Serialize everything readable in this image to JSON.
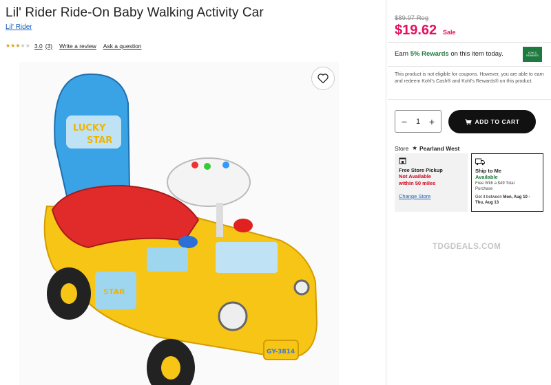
{
  "product": {
    "title": "Lil' Rider Ride-On Baby Walking Activity Car",
    "brand": "Lil' Rider",
    "rating": {
      "stars_filled": 3,
      "stars_total": 5,
      "score": "3.0",
      "count": "(3)"
    },
    "write_review": "Write a review",
    "ask_question": "Ask a question"
  },
  "pricing": {
    "regular": "$89.97 Reg",
    "price": "$19.62",
    "sale_label": "Sale",
    "accent_color": "#e0115f"
  },
  "rewards": {
    "prefix": "Earn ",
    "highlight": "5% Rewards",
    "suffix": " on this item today.",
    "logo_text": "KOHL'S REWARDS"
  },
  "notice": "This product is not eligible for coupons. However, you are able to earn and redeem Kohl's Cash® and Kohl's Rewards® on this product.",
  "cart": {
    "quantity": "1",
    "minus": "−",
    "plus": "+",
    "add_to_cart": "ADD TO CART"
  },
  "store": {
    "label": "Store",
    "name": "Pearland West"
  },
  "pickup": {
    "title": "Free Store Pickup",
    "status_line1": "Not Available",
    "status_line2": "within 50 miles",
    "change_store": "Change Store"
  },
  "ship": {
    "title": "Ship to Me",
    "status": "Available",
    "note_line1": "Free With a $49 Total",
    "note_line2": "Purchase",
    "get_prefix": "Get it between ",
    "get_dates_1": "Mon, Aug 10 -",
    "get_dates_2": "Thu, Aug 13"
  },
  "watermark": "TDGDEALS.COM"
}
